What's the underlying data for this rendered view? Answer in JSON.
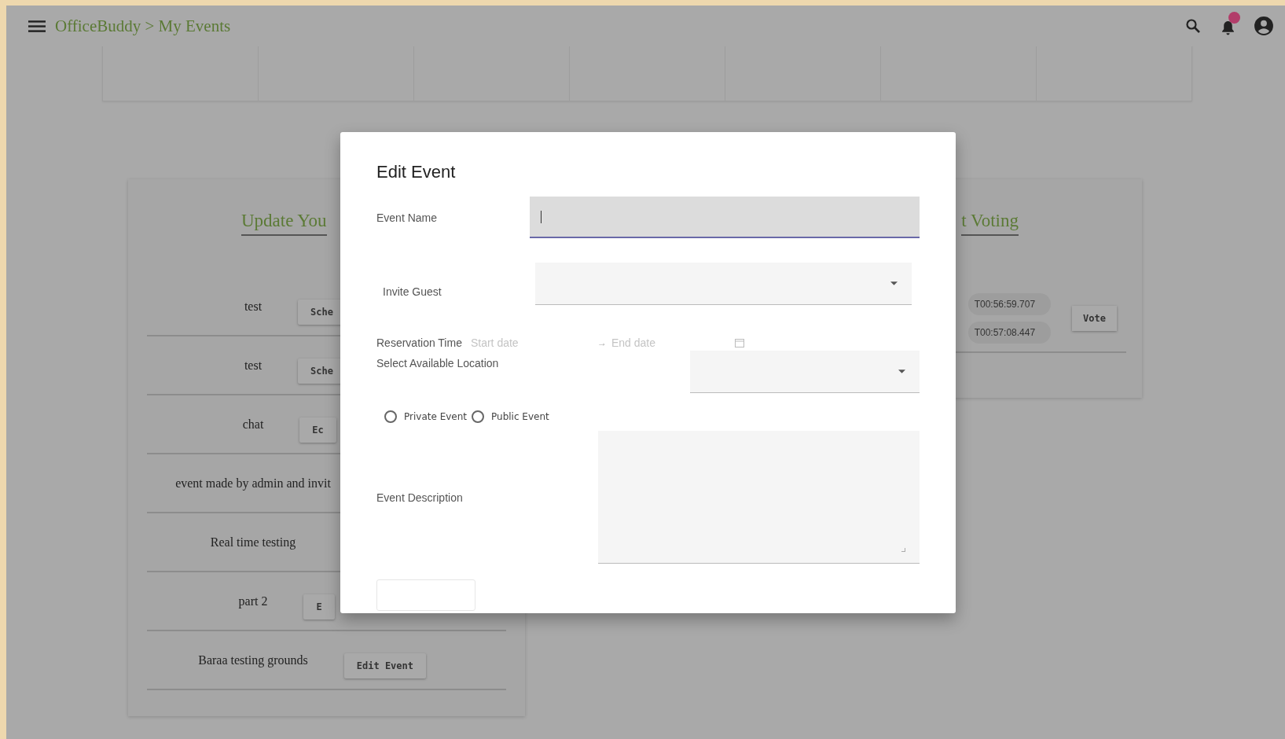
{
  "app_bar": {
    "breadcrumb": "OfficeBuddy > My Events"
  },
  "update_card": {
    "title": "Update You",
    "rows": [
      {
        "name": "test",
        "button": "Sche"
      },
      {
        "name": "test",
        "button": "Sche"
      },
      {
        "name": "chat",
        "button": "Ec"
      },
      {
        "name": "event made by admin and invit"
      },
      {
        "name": "Real time testing"
      },
      {
        "name": "part 2",
        "button": "E"
      },
      {
        "name": "Baraa testing grounds",
        "button": "Edit Event"
      }
    ]
  },
  "voting_card": {
    "title": "t Voting",
    "options": [
      "T00:56:59.707",
      "T00:57:08.447"
    ],
    "button": "Vote"
  },
  "dialog": {
    "title": "Edit Event",
    "fields": [
      {
        "kind": "text",
        "label": "Event Name",
        "focused": true
      },
      {
        "kind": "select",
        "label": "Invite Guest"
      },
      {
        "kind": "daterange",
        "label": "Reservation Time",
        "start_placeholder": "Start date",
        "separator": "→",
        "end_placeholder": "End date"
      },
      {
        "kind": "select",
        "label": "Select Available Location"
      },
      {
        "kind": "radios",
        "options": [
          {
            "label": "Private Event",
            "selected": false
          },
          {
            "label": "Public Event",
            "selected": false
          }
        ]
      },
      {
        "kind": "textarea",
        "label": "Event Description"
      }
    ]
  }
}
